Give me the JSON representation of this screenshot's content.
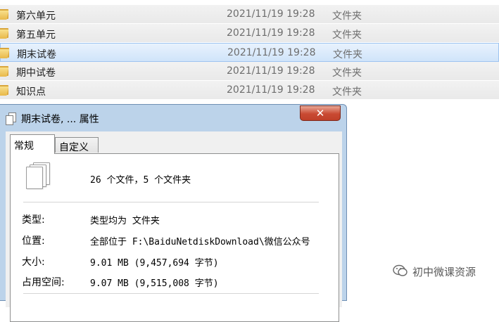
{
  "explorer": {
    "rows": [
      {
        "name": "第六单元",
        "date": "2021/11/19 19:28",
        "type": "文件夹",
        "selected": false
      },
      {
        "name": "第五单元",
        "date": "2021/11/19 19:28",
        "type": "文件夹",
        "selected": false
      },
      {
        "name": "期末试卷",
        "date": "2021/11/19 19:28",
        "type": "文件夹",
        "selected": true
      },
      {
        "name": "期中试卷",
        "date": "2021/11/19 19:28",
        "type": "文件夹",
        "selected": false
      },
      {
        "name": "知识点",
        "date": "2021/11/19 19:28",
        "type": "文件夹",
        "selected": false
      }
    ]
  },
  "dialog": {
    "title": "期末试卷, ... 属性",
    "close_label": "✕",
    "tabs": {
      "general": "常规",
      "custom": "自定义"
    },
    "summary": "26 个文件，5 个文件夹",
    "props": {
      "type_label": "类型:",
      "type_value": "类型均为 文件夹",
      "location_label": "位置:",
      "location_value": "全部位于 F:\\BaiduNetdiskDownload\\微信公众号",
      "size_label": "大小:",
      "size_value": "9.01 MB (9,457,694 字节)",
      "disk_label": "占用空间:",
      "disk_value": "9.07 MB (9,515,008 字节)"
    }
  },
  "watermark": {
    "text": "初中微课资源"
  },
  "colors": {
    "selection": "#cce4fa",
    "close_button": "#c94a33",
    "dialog_frame": "#bcd3ea"
  }
}
